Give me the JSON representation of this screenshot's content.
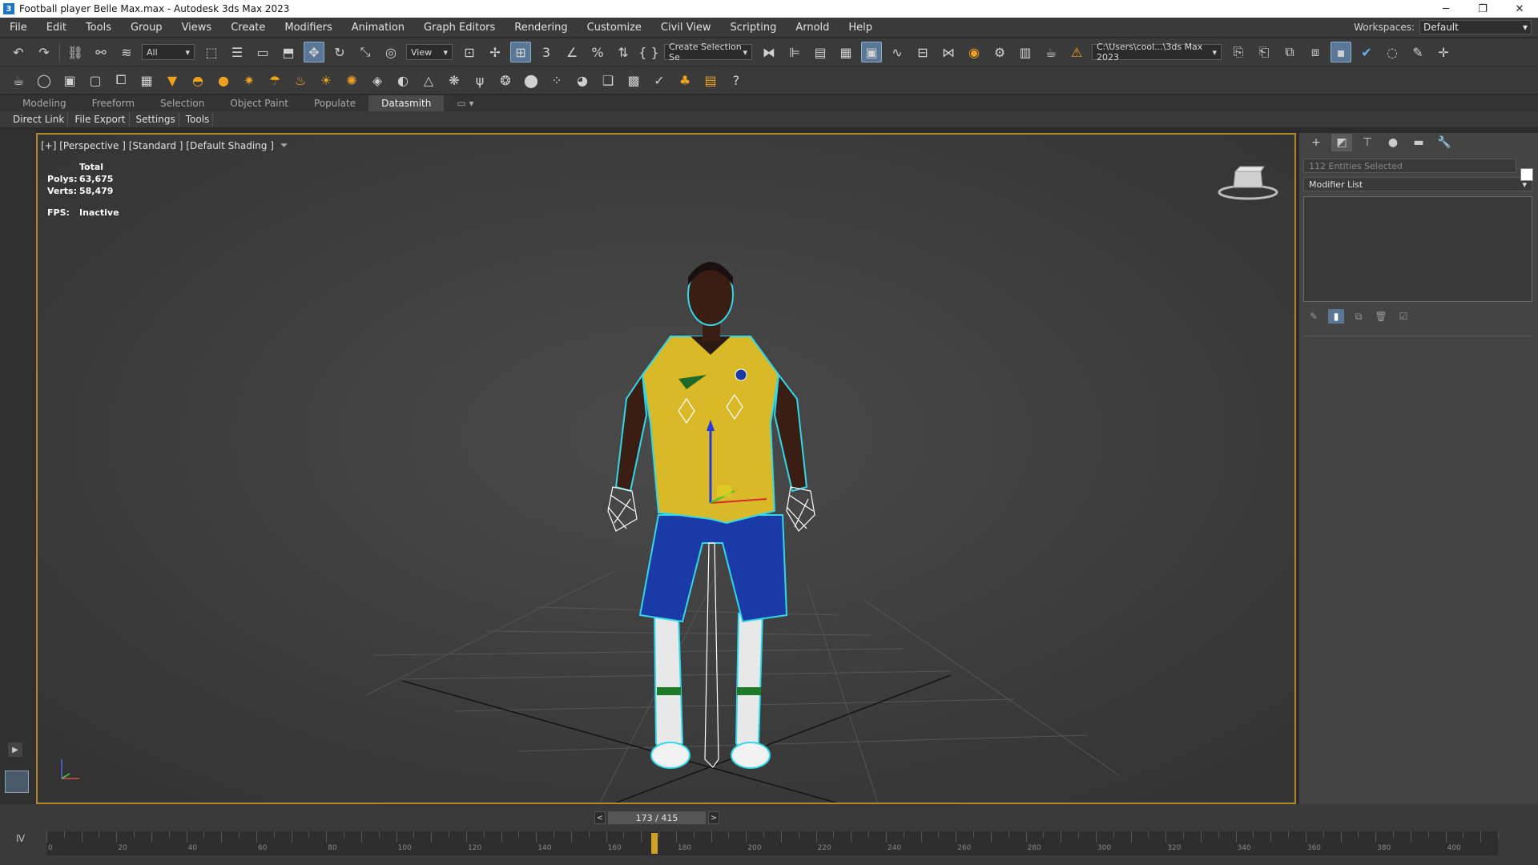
{
  "window": {
    "title": "Football player Belle Max.max - Autodesk 3ds Max 2023",
    "app_icon": "3",
    "minimize": "─",
    "maximize": "❐",
    "close": "✕"
  },
  "menu": [
    "File",
    "Edit",
    "Tools",
    "Group",
    "Views",
    "Create",
    "Modifiers",
    "Animation",
    "Graph Editors",
    "Rendering",
    "Customize",
    "Civil View",
    "Scripting",
    "Arnold",
    "Help"
  ],
  "workspace": {
    "label": "Workspaces:",
    "value": "Default"
  },
  "toolbar1": {
    "selection_filter": "All",
    "ref_coord": "View",
    "named_selection": "Create Selection Se",
    "path": "C:\\Users\\cool...\\3ds Max 2023"
  },
  "ribbon": {
    "tabs": [
      "Modeling",
      "Freeform",
      "Selection",
      "Object Paint",
      "Populate",
      "Datasmith"
    ],
    "active": "Datasmith",
    "subtabs": [
      "Direct Link",
      "File Export",
      "Settings",
      "Tools"
    ]
  },
  "viewport": {
    "label": "[+] [Perspective ] [Standard ] [Default Shading ]",
    "stats": {
      "total_label": "Total",
      "polys_label": "Polys:",
      "polys": "63,675",
      "verts_label": "Verts:",
      "verts": "58,479",
      "fps_label": "FPS:",
      "fps": "Inactive"
    }
  },
  "command_panel": {
    "selection_info": "112 Entities Selected",
    "modifier_list": "Modifier List"
  },
  "timeline": {
    "frame_display": "173 / 415",
    "current_frame": 173,
    "total_frames": 415,
    "prev": "<",
    "next": ">"
  },
  "colors": {
    "accent_border": "#b08a2a",
    "jersey": "#d9b928",
    "shorts": "#1a3aa8",
    "outline": "#30d8e8"
  }
}
